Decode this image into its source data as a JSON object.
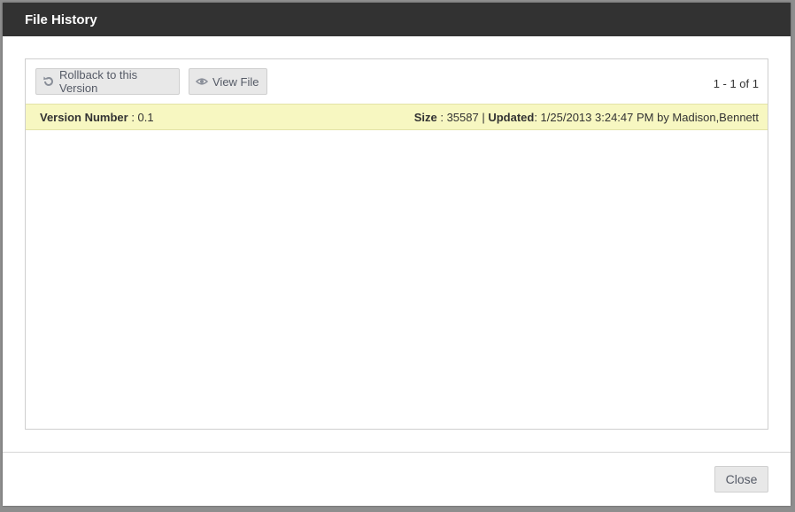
{
  "dialog": {
    "title": "File History"
  },
  "toolbar": {
    "rollback_label": "Rollback to this Version",
    "rollback_icon": "rollback-icon",
    "view_label": "View File",
    "view_icon": "eye-icon",
    "pager_text": "1 - 1 of 1"
  },
  "version": {
    "number_label": "Version Number",
    "number_value": " : 0.1",
    "size_label": "Size",
    "size_value": " : 35587 | ",
    "updated_label": "Updated",
    "updated_value": ": 1/25/2013 3:24:47 PM by Madison,Bennett"
  },
  "footer": {
    "close_label": "Close"
  },
  "colors": {
    "titlebar": "#323232",
    "highlight_row": "#f7f7c1",
    "button_bg": "#e8e8e8"
  }
}
